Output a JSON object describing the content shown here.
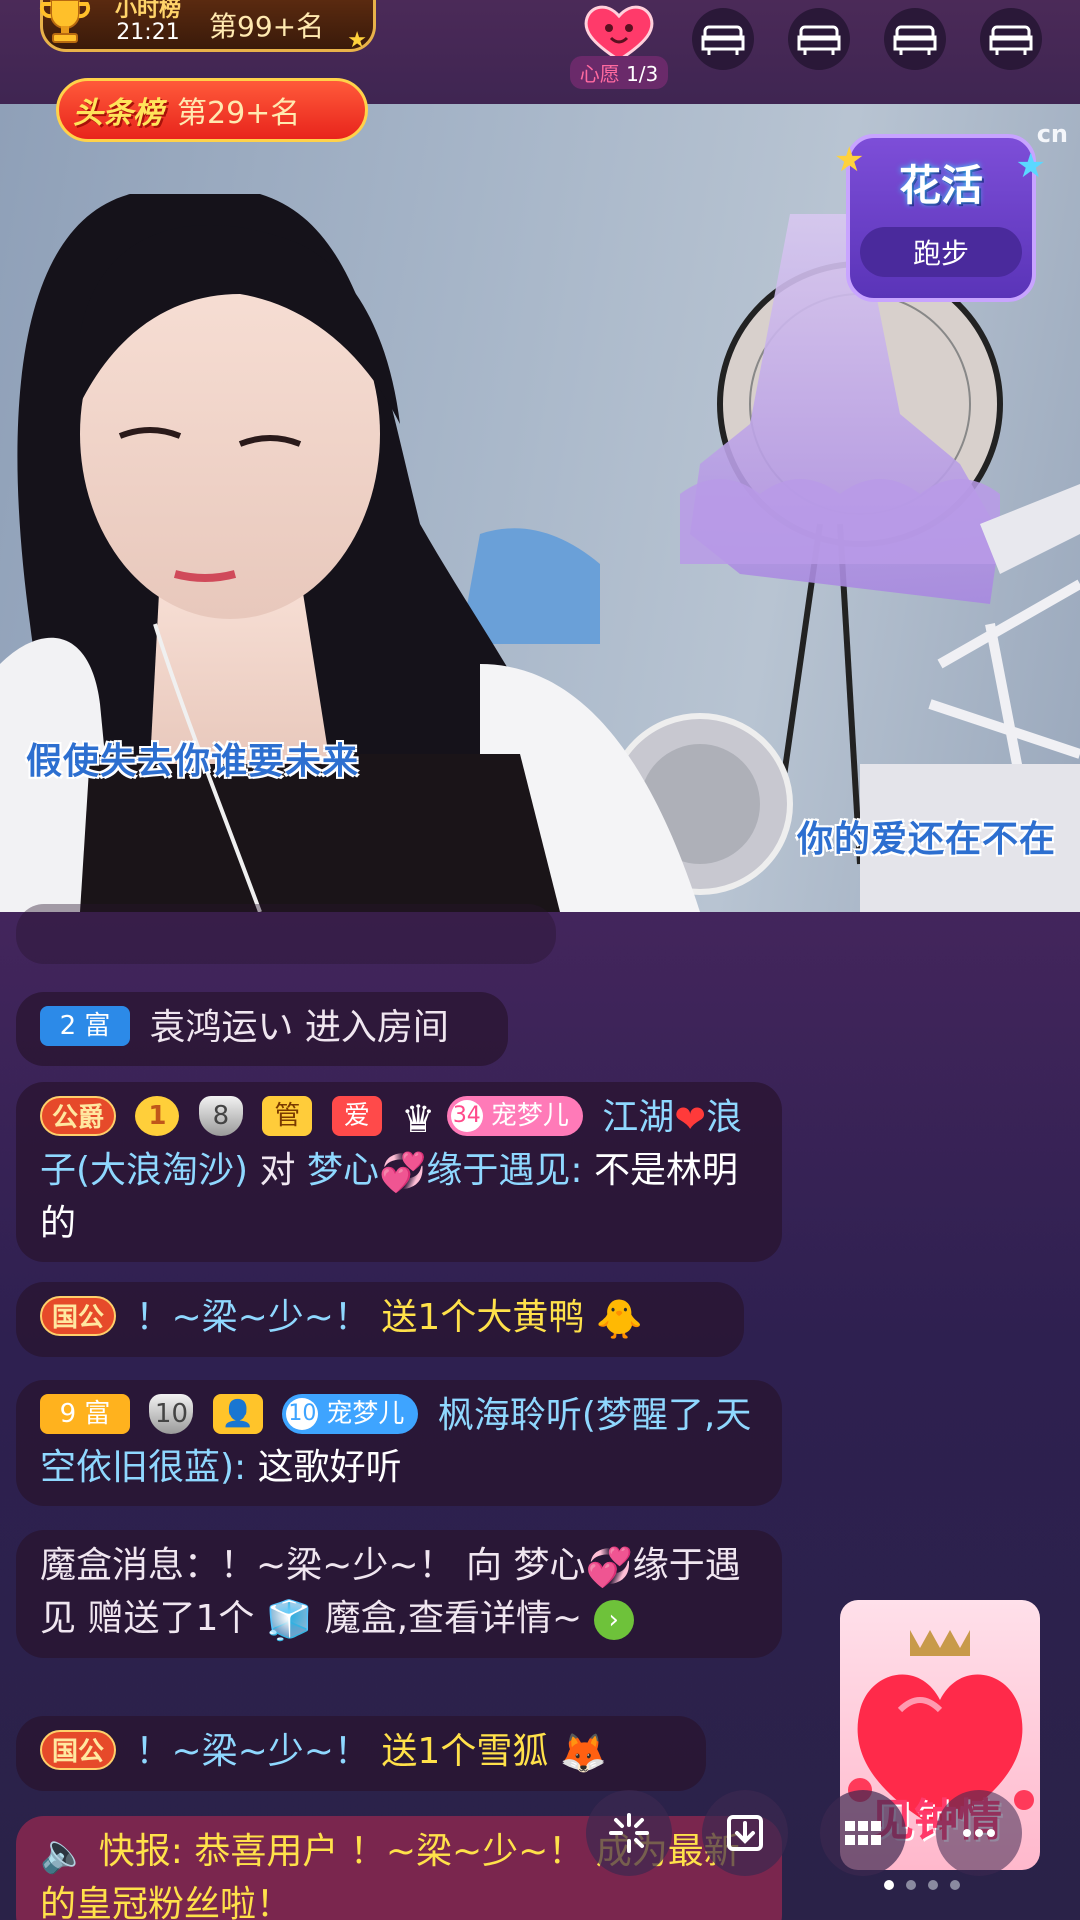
{
  "top_bar": {
    "hour_rank_title": "小时榜",
    "time": "21:21",
    "hour_rank_place": "第99+名",
    "headline_logo": "头条榜",
    "headline_place": "第29+名",
    "wish_prefix": "心愿",
    "wish_count": "1/3",
    "seats": [
      "sofa-seat-1",
      "sofa-seat-2",
      "sofa-seat-3",
      "sofa-seat-4"
    ]
  },
  "video": {
    "lyric_left": "假使失去你谁要未来",
    "lyric_right": "你的爱还在不在",
    "talent_title": "花活",
    "talent_sub": "跑步",
    "watermark": "cn"
  },
  "chat": {
    "msg1": {
      "badge": "2 富",
      "text": "袁鸿运い 进入房间"
    },
    "msg2": {
      "rank_badge": "公爵",
      "level": "1",
      "guard_level": "8",
      "admin": "管",
      "love": "爱",
      "pet_level": "34",
      "pet_name": "宠梦儿",
      "sender": "江湖",
      "sender2": "浪子(大浪淘沙)",
      "verb": "对",
      "target": "梦心",
      "target2": "缘于遇见:",
      "text": "不是林明的"
    },
    "msg3": {
      "rank_badge": "国公",
      "sender": "！~梁~少~！",
      "text": "送1个大黄鸭"
    },
    "msg4": {
      "badge": "9 富",
      "guard_level": "10",
      "pet_level": "10",
      "pet_name": "宠梦儿",
      "sender": "枫海聆听(梦醒了,天空依旧很蓝):",
      "text": "这歌好听"
    },
    "msg5": {
      "prefix": "魔盒消息：",
      "sender": "！~梁~少~！",
      "verb": "向",
      "target": "梦心",
      "target2": "缘于遇见",
      "action": "赠送了1个",
      "item": "魔盒,查看详情~"
    },
    "msg6": {
      "rank_badge": "国公",
      "sender": "！~梁~少~！",
      "text": "送1个雪狐"
    },
    "msg7": {
      "prefix": "快报: 恭喜用户",
      "sender": "！~梁~少~！",
      "text": "成为最新的皇冠粉丝啦！"
    }
  },
  "promo": {
    "text": "见钟情"
  },
  "colors": {
    "accent_yellow": "#ffe14a",
    "name_blue": "#8fd8ff",
    "rich_blue": "#2c8ae8",
    "rich_orange": "#ffb21e"
  },
  "icons": [
    "trophy-icon",
    "heart-icon",
    "sofa-icon",
    "crown-icon",
    "speaker-icon",
    "sparkle-icon",
    "download-icon",
    "grid-icon",
    "more-icon"
  ]
}
